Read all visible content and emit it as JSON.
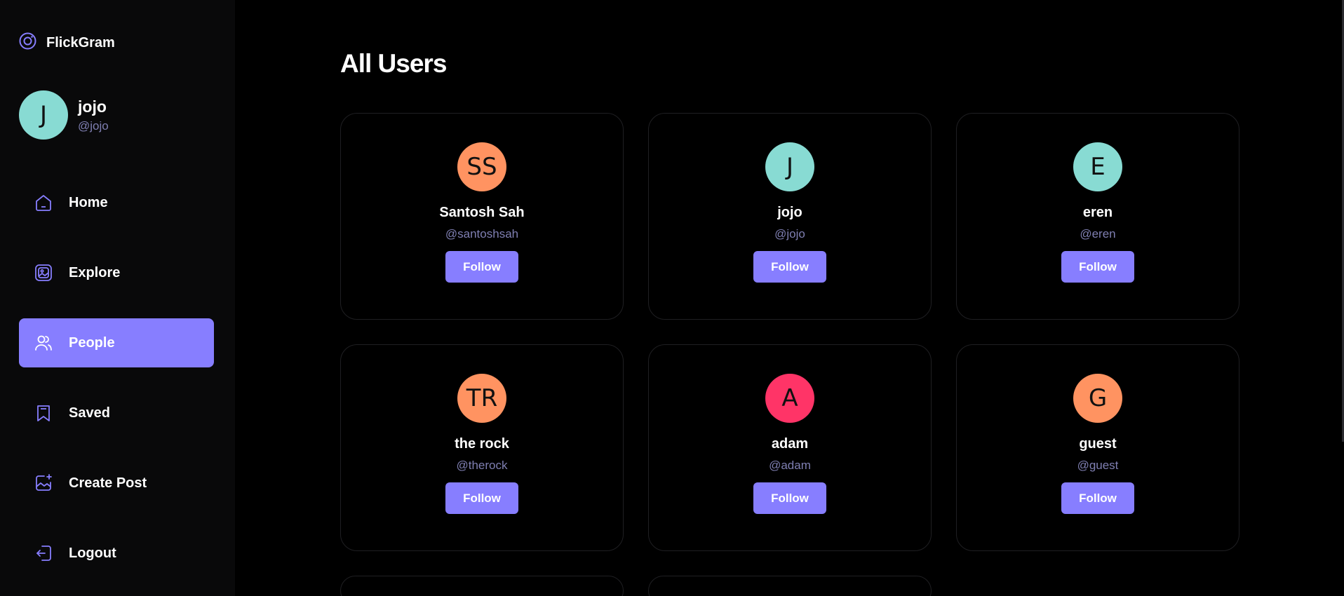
{
  "app": {
    "name": "FlickGram",
    "accent": "#877eff"
  },
  "profile": {
    "initial": "J",
    "name": "jojo",
    "handle": "@jojo",
    "avatar_color": "#88dbd3"
  },
  "nav": [
    {
      "label": "Home",
      "icon": "home-icon",
      "active": false
    },
    {
      "label": "Explore",
      "icon": "gallery-icon",
      "active": false
    },
    {
      "label": "People",
      "icon": "people-icon",
      "active": true
    },
    {
      "label": "Saved",
      "icon": "bookmark-icon",
      "active": false
    },
    {
      "label": "Create Post",
      "icon": "image-plus-icon",
      "active": false
    },
    {
      "label": "Logout",
      "icon": "logout-icon",
      "active": false
    }
  ],
  "main": {
    "title": "All Users",
    "follow_label": "Follow",
    "users": [
      {
        "initials": "SS",
        "name": "Santosh Sah",
        "handle": "@santoshsah",
        "color": "#ff9361"
      },
      {
        "initials": "J",
        "name": "jojo",
        "handle": "@jojo",
        "color": "#88dbd3"
      },
      {
        "initials": "E",
        "name": "eren",
        "handle": "@eren",
        "color": "#88dbd3"
      },
      {
        "initials": "TR",
        "name": "the rock",
        "handle": "@therock",
        "color": "#ff9361"
      },
      {
        "initials": "A",
        "name": "adam",
        "handle": "@adam",
        "color": "#ff3467"
      },
      {
        "initials": "G",
        "name": "guest",
        "handle": "@guest",
        "color": "#ff9361"
      }
    ]
  }
}
